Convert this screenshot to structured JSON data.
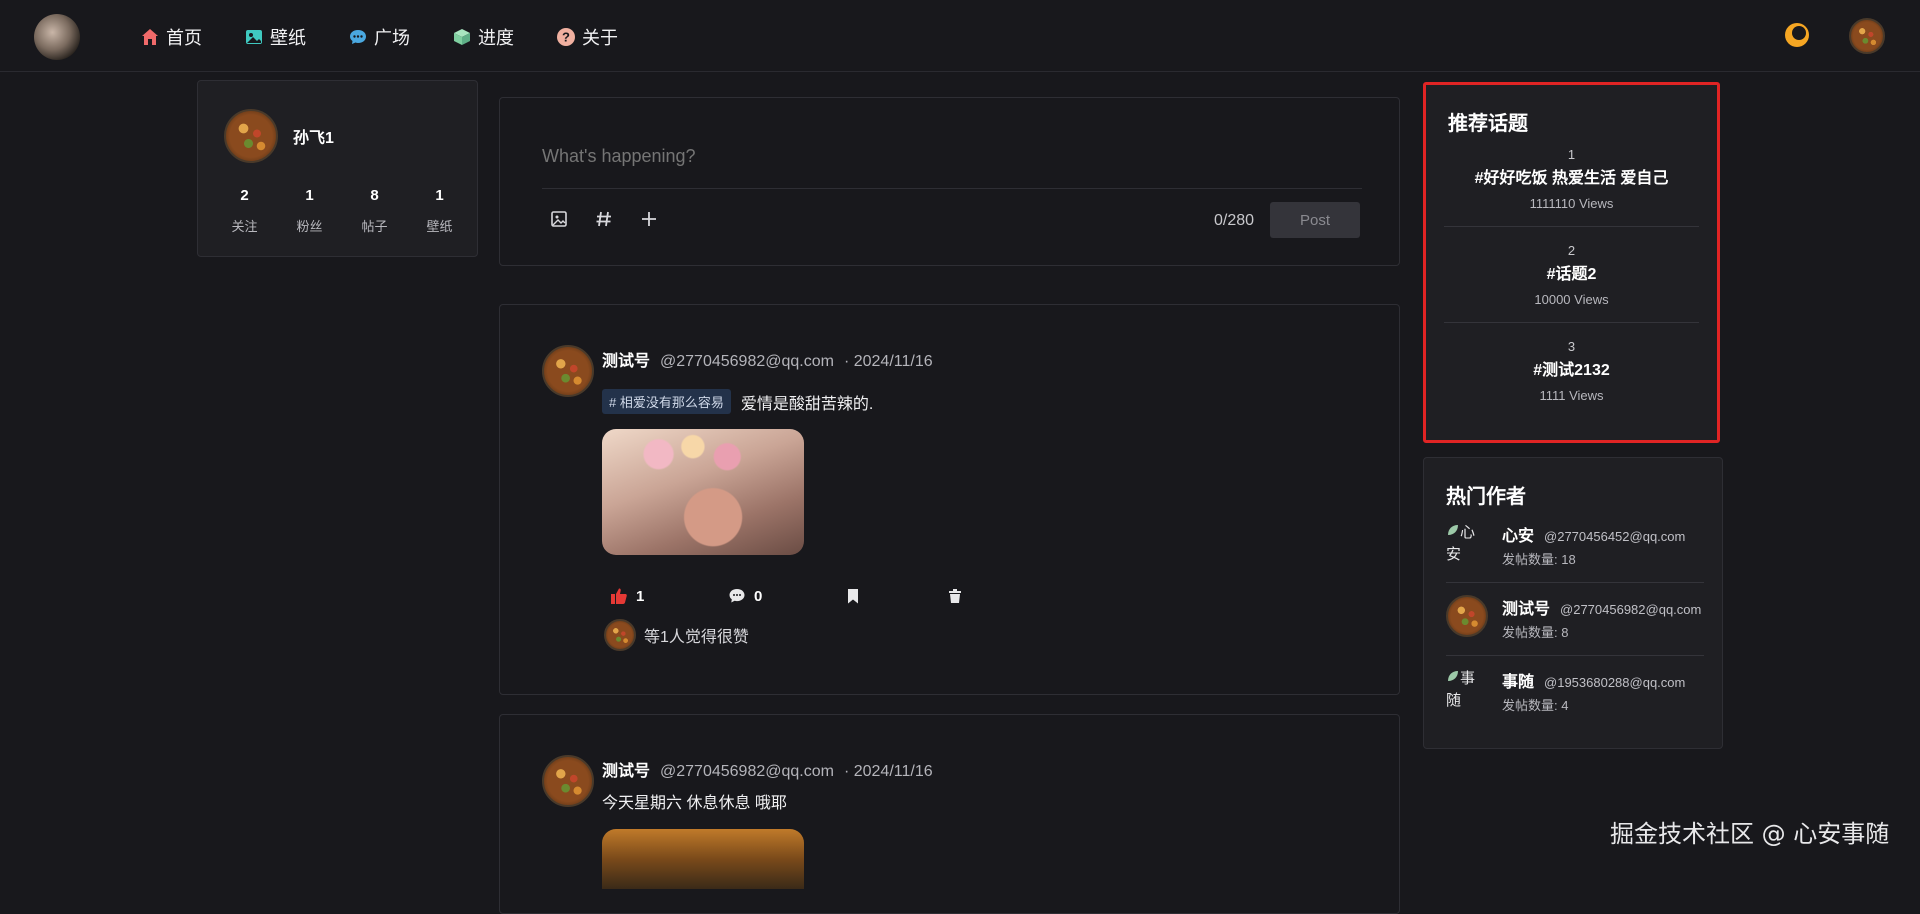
{
  "nav": {
    "items": [
      {
        "label": "首页",
        "icon": "home-icon",
        "color": "#f06a6a"
      },
      {
        "label": "壁纸",
        "icon": "image-icon",
        "color": "#3fc9c0"
      },
      {
        "label": "广场",
        "icon": "chat-icon",
        "color": "#4aa8e0"
      },
      {
        "label": "进度",
        "icon": "cube-icon",
        "color": "#7fcfa0"
      },
      {
        "label": "关于",
        "icon": "question-icon",
        "color": "#f0b0a0"
      }
    ]
  },
  "profile": {
    "name": "孙飞1",
    "stats": [
      {
        "value": "2",
        "label": "关注"
      },
      {
        "value": "1",
        "label": "粉丝"
      },
      {
        "value": "8",
        "label": "帖子"
      },
      {
        "value": "1",
        "label": "壁纸"
      }
    ]
  },
  "composer": {
    "placeholder": "What's happening?",
    "char_count": "0/280",
    "post_label": "Post"
  },
  "posts": [
    {
      "author": "测试号",
      "handle": "@2770456982@qq.com",
      "date": "· 2024/11/16",
      "tag": "# 相爱没有那么容易",
      "text": "爱情是酸甜苦辣的.",
      "likes": "1",
      "comments": "0",
      "likers_text": "等1人觉得很赞"
    },
    {
      "author": "测试号",
      "handle": "@2770456982@qq.com",
      "date": "· 2024/11/16",
      "text": "今天星期六 休息休息 哦耶"
    }
  ],
  "topics": {
    "title": "推荐话题",
    "items": [
      {
        "rank": "1",
        "name": "#好好吃饭 热爱生活 爱自己",
        "views": "1111110 Views"
      },
      {
        "rank": "2",
        "name": "#话题2",
        "views": "10000 Views"
      },
      {
        "rank": "3",
        "name": "#测试2132",
        "views": "1111 Views"
      }
    ]
  },
  "authors": {
    "title": "热门作者",
    "items": [
      {
        "name": "心安",
        "email": "@2770456452@qq.com",
        "posts": "发帖数量: 18",
        "alt": "心安"
      },
      {
        "name": "测试号",
        "email": "@2770456982@qq.com",
        "posts": "发帖数量: 8",
        "alt": ""
      },
      {
        "name": "事随",
        "email": "@1953680288@qq.com",
        "posts": "发帖数量: 4",
        "alt": "事随"
      }
    ]
  },
  "watermark": "掘金技术社区 @ 心安事随",
  "colors": {
    "accent_red": "#e02424",
    "like_red": "#e53935",
    "theme_toggle": "#f5a623"
  }
}
